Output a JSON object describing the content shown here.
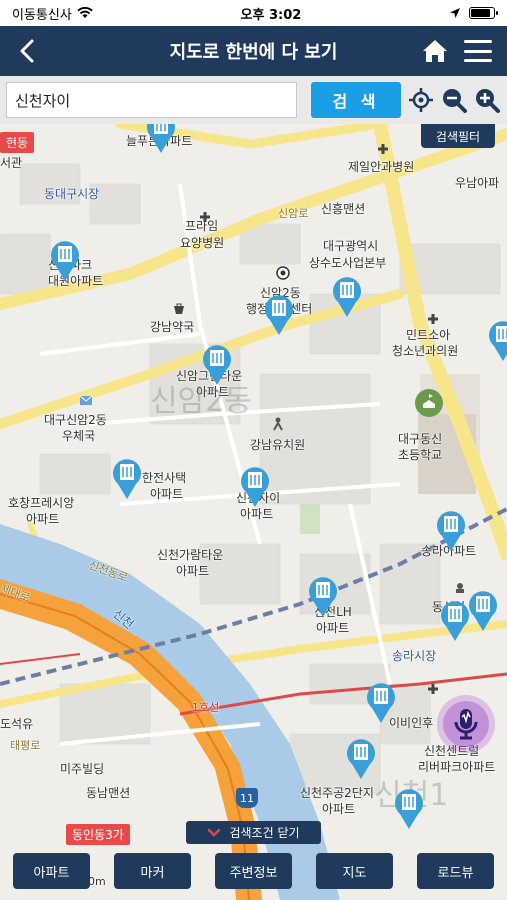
{
  "status": {
    "carrier": "이동통신사",
    "time": "오후 3:02"
  },
  "header": {
    "title": "지도로 한번에 다 보기"
  },
  "search": {
    "value": "신천자이",
    "button_label": "검 색"
  },
  "filter_label": "검색필터",
  "map_labels": {
    "hyeondong": "현동",
    "seogwan": "서관",
    "neulpureun": "늘푸른아파트",
    "jeil": "제일안과병원",
    "dongdaegu": "동대구시장",
    "uname": "우남아파",
    "sinam_road": "신암로",
    "sinheung": "신흥맨션",
    "prime1": "프라임",
    "prime2": "요양병원",
    "suwater1": "대구광역시",
    "suwater2": "상수도사업본부",
    "park1": "신천파크",
    "park2": "대원아파트",
    "sinam2_1": "신암2동",
    "sinam2_2": "행정복지센터",
    "gangnam_pharm": "강남약국",
    "mintsoa1": "민트소아",
    "mintsoa2": "청소년과의원",
    "golden1": "신암그린타운",
    "golden2": "아파트",
    "sinam2_big": "신암2동",
    "post1": "대구신암2동",
    "post2": "우체국",
    "kinder": "강남유치원",
    "school1": "대구동신",
    "school2": "초등학교",
    "hanjeon1": "한전사택",
    "hanjeon2": "아파트",
    "jai1": "신천자이",
    "jai2": "아파트",
    "hochang1": "호창프레시앙",
    "hochang2": "아파트",
    "songra_apt": "송라아파트",
    "garam1": "신천가람타운",
    "garam2": "아파트",
    "sincheon_road": "신천동로",
    "jaedae": "제대로",
    "sincheon": "신천",
    "lh1": "신천LH",
    "lh2": "아파트",
    "dongsincheon": "동신천",
    "songra_market": "송라시장",
    "line1": "1호선",
    "seokyu": "도석유",
    "ibi": "이비인후",
    "sincheon_riverpark1": "신천센트럴",
    "sincheon_riverpark2": "리버파크아파트",
    "taepyeong": "태평로",
    "mido": "미주빌딩",
    "dongnam": "동남맨션",
    "jugong1": "신천주공2단지",
    "jugong2": "아파트",
    "route11": "11",
    "sincheon1_big": "신천1",
    "dongin": "동인동3가",
    "scale": "0m"
  },
  "close_conditions_label": "검색조건 닫기",
  "bottom_buttons": [
    "아파트",
    "마커",
    "주변정보",
    "지도",
    "로드뷰"
  ],
  "colors": {
    "nav": "#1f3a5c",
    "search_button": "#1a9ee6",
    "pin": "#3a9fd8"
  }
}
